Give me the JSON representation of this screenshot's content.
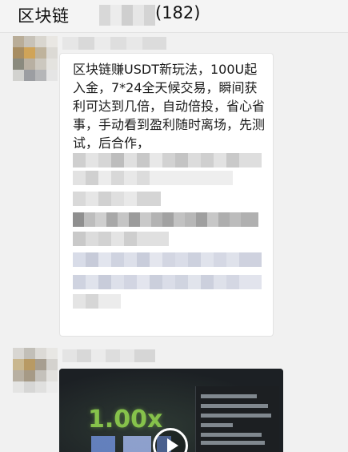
{
  "window": {
    "chat_title": "区块链",
    "member_count": "(182)"
  },
  "messages": [
    {
      "type": "text",
      "text": "区块链赚USDT新玩法，100U起入金，7*24全天候交易，瞬间获利可达到几倍，自动倍投，省心省事，手动看到盈利随时离场，先测试，后合作，"
    },
    {
      "type": "video",
      "overlay_text": "1.00x"
    }
  ],
  "colors": {
    "background": "#f1f1f1",
    "bubble": "#ffffff",
    "multiplier": "#86c24b",
    "video_bg": "#23272a"
  },
  "icons": {
    "play": "play-icon"
  }
}
